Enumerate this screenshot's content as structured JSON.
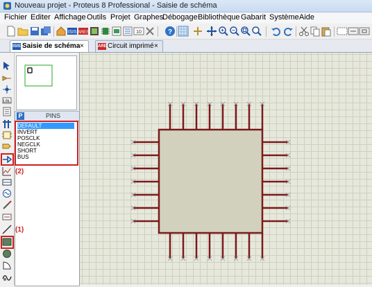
{
  "window": {
    "title": "Nouveau projet - Proteus 8 Professional - Saisie de schéma"
  },
  "menu": [
    "Fichier",
    "Editer",
    "Affichage",
    "Outils",
    "Projet",
    "Graphes",
    "Débogage",
    "Bibliothèque",
    "Gabarit",
    "Système",
    "Aide"
  ],
  "tabs": [
    {
      "label": "Saisie de schéma",
      "icon": "ISIS",
      "close": "×"
    },
    {
      "label": "Circuit imprimé",
      "icon": "ARES",
      "close": "×"
    }
  ],
  "pins_panel": {
    "badge": "P",
    "title": "PINS",
    "items": [
      "DEFAULT",
      "INVERT",
      "POSCLK",
      "NEGCLK",
      "SHORT",
      "BUS"
    ],
    "selected_index": 0
  },
  "annotations": {
    "label_1": "(1)",
    "label_2": "(2)",
    "highlight_color": "#d02020"
  },
  "toolbar_icons": [
    "new-file-icon",
    "open-folder-icon",
    "save-icon",
    "save-all-icon",
    "isis-icon",
    "schematic-icon",
    "ares-icon",
    "chip-icon",
    "image-icon",
    "module-icon",
    "delete-icon",
    "3d-icon",
    "help-icon",
    "refresh-icon",
    "grid-icon",
    "origin-icon",
    "pan-icon",
    "zoom-in-icon",
    "zoom-out-icon",
    "zoom-all-icon",
    "zoom-area-icon",
    "undo-icon",
    "redo-icon",
    "cut-icon",
    "copy-icon",
    "paste-icon",
    "block-copy-icon",
    "block-move-icon",
    "block-rotate-icon",
    "block-delete-icon"
  ],
  "left_tools": [
    "select-icon",
    "component-icon",
    "junction-icon",
    "wire-label-icon",
    "text-script-icon",
    "bus-icon",
    "subcircuit-icon",
    "terminal-icon",
    "device-pin-icon",
    "graph-icon",
    "tape-recorder-icon",
    "generator-icon",
    "voltage-probe-icon",
    "current-probe-icon",
    "virtual-instrument-icon",
    "line-icon",
    "box-icon",
    "circle-icon",
    "arc-icon",
    "path-icon"
  ],
  "colors": {
    "component_outline": "#7a1a1a",
    "component_fill": "#d2d1bd",
    "pin_color": "#7a1a1a",
    "grid_bg": "#e7e8dc"
  }
}
